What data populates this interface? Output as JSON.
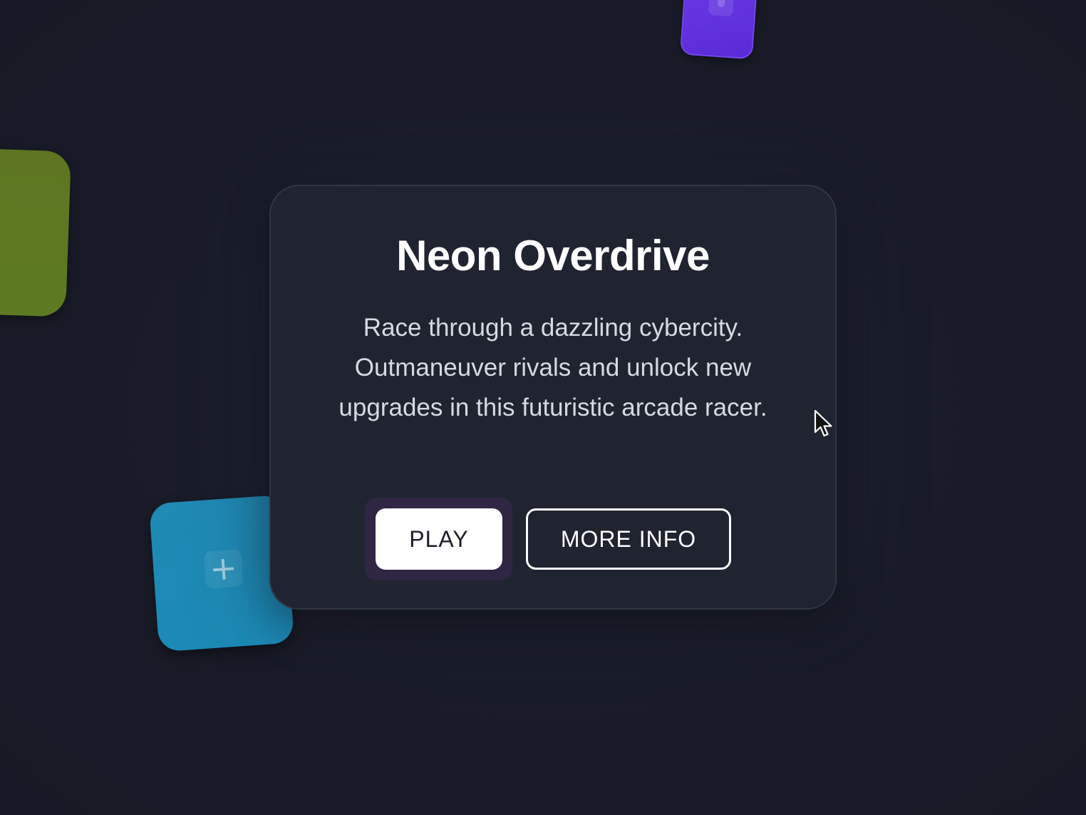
{
  "game": {
    "title": "Neon Overdrive",
    "description": "Race through a dazzling cybercity. Outmaneuver rivals and unlock new upgrades in this futuristic arcade racer."
  },
  "buttons": {
    "play_label": "PLAY",
    "more_info_label": "MORE INFO"
  },
  "decor": {
    "tiles": [
      {
        "name": "purple-tile",
        "color": "#5f30dc",
        "icon": "gamepad-icon"
      },
      {
        "name": "green-tile",
        "color": "#5e7822"
      },
      {
        "name": "blue-tile",
        "color": "#1e8ab5",
        "icon": "plus-icon",
        "glyph": "+"
      }
    ]
  },
  "colors": {
    "background": "#191b28",
    "card": "#202430",
    "card_border": "#2f3544",
    "play_button": "#ffffff",
    "play_focus_ring": "#2e2643"
  }
}
